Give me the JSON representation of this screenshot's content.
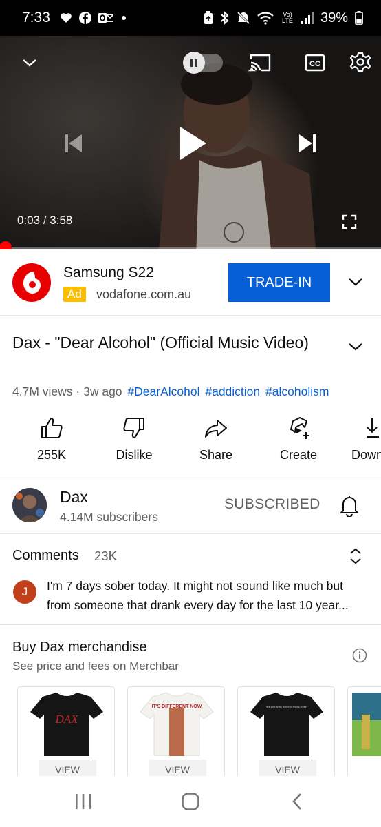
{
  "status_bar": {
    "time": "7:33",
    "battery": "39%",
    "notification_icons": [
      "heart-icon",
      "facebook-icon",
      "outlook-icon",
      "dot-icon"
    ],
    "system_icons": [
      "nfc-icon",
      "bluetooth-icon",
      "mute-icon",
      "wifi-icon",
      "volte-icon",
      "signal-icon",
      "battery-icon"
    ],
    "volte_label": "Vo)\nLTE"
  },
  "player": {
    "current_time": "0:03",
    "separator": "/",
    "duration": "3:58",
    "progress_fraction": 0.013,
    "state": "paused",
    "progress_color": "#ff0000"
  },
  "ad": {
    "title": "Samsung S22",
    "badge": "Ad",
    "domain": "vodafone.com.au",
    "cta": "TRADE-IN",
    "cta_color": "#065fd4",
    "badge_color": "#fbbc04",
    "logo_color": "#e60000"
  },
  "video": {
    "title": "Dax - \"Dear Alcohol\" (Official Music Video)",
    "views": "4.7M views",
    "dot": "·",
    "age": "3w ago",
    "hashtags": [
      "#DearAlcohol",
      "#addiction",
      "#alcoholism"
    ]
  },
  "actions": [
    {
      "label": "255K",
      "icon": "thumbs-up-icon"
    },
    {
      "label": "Dislike",
      "icon": "thumbs-down-icon"
    },
    {
      "label": "Share",
      "icon": "share-icon"
    },
    {
      "label": "Create",
      "icon": "create-icon"
    },
    {
      "label": "Down",
      "icon": "download-icon"
    }
  ],
  "channel": {
    "name": "Dax",
    "subscribers": "4.14M subscribers",
    "subscribe_state": "SUBSCRIBED"
  },
  "comments": {
    "heading": "Comments",
    "count": "23K",
    "first_author_initial": "J",
    "first_comment": "I'm 7 days sober today. It might not sound like much but from someone that drank every day for the last 10 year..."
  },
  "merch": {
    "title": "Buy Dax merchandise",
    "subtitle": "See price and fees on Merchbar",
    "items": [
      {
        "view_label": "VIEW",
        "print_text": "DAX"
      },
      {
        "view_label": "VIEW",
        "print_text": "IT'S DIFFERENT NOW"
      },
      {
        "view_label": "VIEW",
        "print_text": "\"Are you dying to live or living to die?\""
      }
    ]
  },
  "nav": {
    "buttons": [
      "recent-apps-icon",
      "home-icon",
      "back-icon"
    ]
  }
}
